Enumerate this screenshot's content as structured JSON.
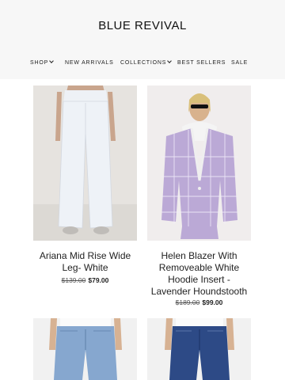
{
  "brand": "BLUE REVIVAL",
  "nav": [
    {
      "label": "SHOP",
      "dropdown": true
    },
    {
      "label": "NEW ARRIVALS",
      "dropdown": false
    },
    {
      "label": "COLLECTIONS",
      "dropdown": true
    },
    {
      "label": "BEST SELLERS",
      "dropdown": false
    },
    {
      "label": "SALE",
      "dropdown": false
    }
  ],
  "products": [
    {
      "title": "Ariana Mid Rise Wide Leg- White",
      "old_price": "$139.00",
      "price": "$79.00"
    },
    {
      "title": "Helen Blazer With Removeable White Hoodie Insert - Lavender Houndstooth",
      "old_price": "$189.00",
      "price": "$99.00"
    }
  ],
  "colors": {
    "header_bg": "#f7f7f7",
    "text": "#222222",
    "blazer": "#bba9d6",
    "denim": "#7b9fc9",
    "denim_dark": "#2d4a86"
  }
}
